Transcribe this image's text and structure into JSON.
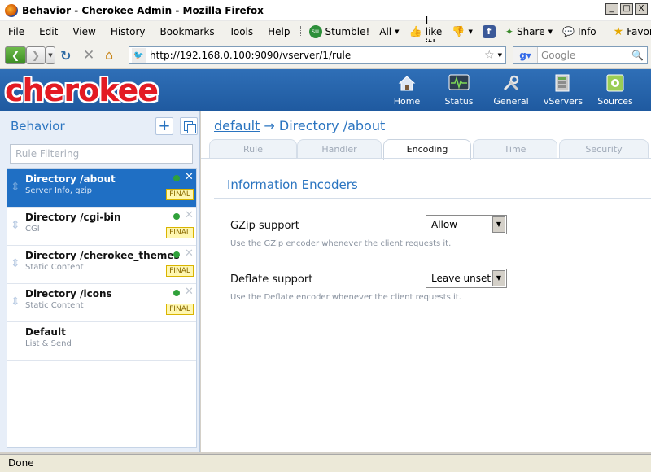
{
  "window": {
    "title": "Behavior - Cherokee Admin - Mozilla Firefox",
    "controls": [
      "_",
      "□",
      "X"
    ]
  },
  "menubar": {
    "items": [
      "File",
      "Edit",
      "View",
      "History",
      "Bookmarks",
      "Tools",
      "Help"
    ],
    "toolbar": {
      "stumble": "Stumble!",
      "all": "All",
      "ilike": "I like it!",
      "share": "Share",
      "info": "Info",
      "favorites": "Favorites"
    }
  },
  "navbar": {
    "url": "http://192.168.0.100:9090/vserver/1/rule",
    "search_placeholder": "Google"
  },
  "header": {
    "logo": "cherokee",
    "nav": [
      {
        "label": "Home",
        "icon": "home-icon"
      },
      {
        "label": "Status",
        "icon": "status-monitor-icon"
      },
      {
        "label": "General",
        "icon": "tools-icon"
      },
      {
        "label": "vServers",
        "icon": "servers-icon"
      },
      {
        "label": "Sources",
        "icon": "sources-icon"
      }
    ]
  },
  "sidebar": {
    "title": "Behavior",
    "filter_placeholder": "Rule Filtering",
    "rules": [
      {
        "name": "Directory /about",
        "desc": "Server Info, gzip",
        "final": "FINAL",
        "active": true
      },
      {
        "name": "Directory /cgi-bin",
        "desc": "CGI",
        "final": "FINAL",
        "active": false
      },
      {
        "name": "Directory /cherokee_themes",
        "desc": "Static Content",
        "final": "FINAL",
        "active": false
      },
      {
        "name": "Directory /icons",
        "desc": "Static Content",
        "final": "FINAL",
        "active": false
      },
      {
        "name": "Default",
        "desc": "List & Send",
        "final": "",
        "active": false
      }
    ]
  },
  "main": {
    "breadcrumb_link": "default",
    "breadcrumb_rest": " → Directory /about",
    "tabs": [
      "Rule",
      "Handler",
      "Encoding",
      "Time",
      "Security"
    ],
    "active_tab": "Encoding",
    "section_title": "Information Encoders",
    "fields": [
      {
        "label": "GZip support",
        "value": "Allow",
        "help": "Use the GZip encoder whenever the client requests it."
      },
      {
        "label": "Deflate support",
        "value": "Leave unset",
        "help": "Use the Deflate encoder whenever the client requests it."
      }
    ]
  },
  "statusbar": {
    "text": "Done"
  },
  "colors": {
    "brand_red": "#e31b23",
    "header_blue": "#2563a8",
    "accent_blue": "#2a74c0",
    "active_rule": "#1f6fc4",
    "final_badge": "#fff7b0"
  }
}
